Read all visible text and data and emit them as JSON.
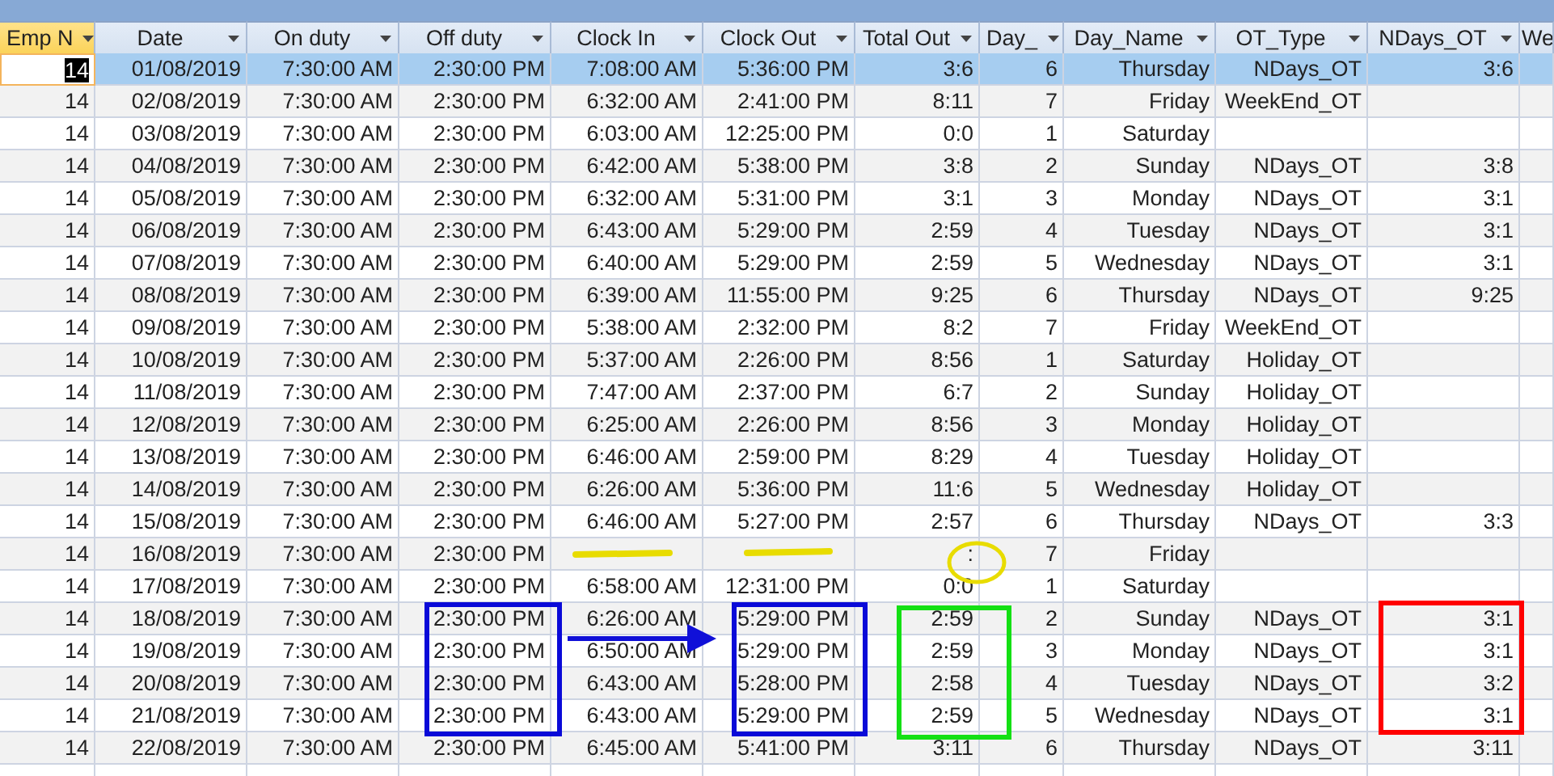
{
  "table": {
    "columns": [
      {
        "label": "Emp N",
        "selected": true
      },
      {
        "label": "Date",
        "selected": false
      },
      {
        "label": "On duty",
        "selected": false
      },
      {
        "label": "Off duty",
        "selected": false
      },
      {
        "label": "Clock In",
        "selected": false
      },
      {
        "label": "Clock Out",
        "selected": false
      },
      {
        "label": "Total Out",
        "selected": false
      },
      {
        "label": "Day_",
        "selected": false
      },
      {
        "label": "Day_Name",
        "selected": false
      },
      {
        "label": "OT_Type",
        "selected": false
      },
      {
        "label": "NDays_OT",
        "selected": false
      },
      {
        "label": "We",
        "selected": false
      }
    ],
    "rows": [
      {
        "selected": true,
        "cells": [
          "14",
          "01/08/2019",
          "7:30:00 AM",
          "2:30:00 PM",
          "7:08:00 AM",
          "5:36:00 PM",
          "3:6",
          "6",
          "Thursday",
          "NDays_OT",
          "3:6"
        ]
      },
      {
        "selected": false,
        "cells": [
          "14",
          "02/08/2019",
          "7:30:00 AM",
          "2:30:00 PM",
          "6:32:00 AM",
          "2:41:00 PM",
          "8:11",
          "7",
          "Friday",
          "WeekEnd_OT",
          ""
        ]
      },
      {
        "selected": false,
        "cells": [
          "14",
          "03/08/2019",
          "7:30:00 AM",
          "2:30:00 PM",
          "6:03:00 AM",
          "12:25:00 PM",
          "0:0",
          "1",
          "Saturday",
          "",
          ""
        ]
      },
      {
        "selected": false,
        "cells": [
          "14",
          "04/08/2019",
          "7:30:00 AM",
          "2:30:00 PM",
          "6:42:00 AM",
          "5:38:00 PM",
          "3:8",
          "2",
          "Sunday",
          "NDays_OT",
          "3:8"
        ]
      },
      {
        "selected": false,
        "cells": [
          "14",
          "05/08/2019",
          "7:30:00 AM",
          "2:30:00 PM",
          "6:32:00 AM",
          "5:31:00 PM",
          "3:1",
          "3",
          "Monday",
          "NDays_OT",
          "3:1"
        ]
      },
      {
        "selected": false,
        "cells": [
          "14",
          "06/08/2019",
          "7:30:00 AM",
          "2:30:00 PM",
          "6:43:00 AM",
          "5:29:00 PM",
          "2:59",
          "4",
          "Tuesday",
          "NDays_OT",
          "3:1"
        ]
      },
      {
        "selected": false,
        "cells": [
          "14",
          "07/08/2019",
          "7:30:00 AM",
          "2:30:00 PM",
          "6:40:00 AM",
          "5:29:00 PM",
          "2:59",
          "5",
          "Wednesday",
          "NDays_OT",
          "3:1"
        ]
      },
      {
        "selected": false,
        "cells": [
          "14",
          "08/08/2019",
          "7:30:00 AM",
          "2:30:00 PM",
          "6:39:00 AM",
          "11:55:00 PM",
          "9:25",
          "6",
          "Thursday",
          "NDays_OT",
          "9:25"
        ]
      },
      {
        "selected": false,
        "cells": [
          "14",
          "09/08/2019",
          "7:30:00 AM",
          "2:30:00 PM",
          "5:38:00 AM",
          "2:32:00 PM",
          "8:2",
          "7",
          "Friday",
          "WeekEnd_OT",
          ""
        ]
      },
      {
        "selected": false,
        "cells": [
          "14",
          "10/08/2019",
          "7:30:00 AM",
          "2:30:00 PM",
          "5:37:00 AM",
          "2:26:00 PM",
          "8:56",
          "1",
          "Saturday",
          "Holiday_OT",
          ""
        ]
      },
      {
        "selected": false,
        "cells": [
          "14",
          "11/08/2019",
          "7:30:00 AM",
          "2:30:00 PM",
          "7:47:00 AM",
          "2:37:00 PM",
          "6:7",
          "2",
          "Sunday",
          "Holiday_OT",
          ""
        ]
      },
      {
        "selected": false,
        "cells": [
          "14",
          "12/08/2019",
          "7:30:00 AM",
          "2:30:00 PM",
          "6:25:00 AM",
          "2:26:00 PM",
          "8:56",
          "3",
          "Monday",
          "Holiday_OT",
          ""
        ]
      },
      {
        "selected": false,
        "cells": [
          "14",
          "13/08/2019",
          "7:30:00 AM",
          "2:30:00 PM",
          "6:46:00 AM",
          "2:59:00 PM",
          "8:29",
          "4",
          "Tuesday",
          "Holiday_OT",
          ""
        ]
      },
      {
        "selected": false,
        "cells": [
          "14",
          "14/08/2019",
          "7:30:00 AM",
          "2:30:00 PM",
          "6:26:00 AM",
          "5:36:00 PM",
          "11:6",
          "5",
          "Wednesday",
          "Holiday_OT",
          ""
        ]
      },
      {
        "selected": false,
        "cells": [
          "14",
          "15/08/2019",
          "7:30:00 AM",
          "2:30:00 PM",
          "6:46:00 AM",
          "5:27:00 PM",
          "2:57",
          "6",
          "Thursday",
          "NDays_OT",
          "3:3"
        ]
      },
      {
        "selected": false,
        "cells": [
          "14",
          "16/08/2019",
          "7:30:00 AM",
          "2:30:00 PM",
          "",
          "",
          ":",
          "7",
          "Friday",
          "",
          ""
        ]
      },
      {
        "selected": false,
        "cells": [
          "14",
          "17/08/2019",
          "7:30:00 AM",
          "2:30:00 PM",
          "6:58:00 AM",
          "12:31:00 PM",
          "0:0",
          "1",
          "Saturday",
          "",
          ""
        ]
      },
      {
        "selected": false,
        "cells": [
          "14",
          "18/08/2019",
          "7:30:00 AM",
          "2:30:00 PM",
          "6:26:00 AM",
          "5:29:00 PM",
          "2:59",
          "2",
          "Sunday",
          "NDays_OT",
          "3:1"
        ]
      },
      {
        "selected": false,
        "cells": [
          "14",
          "19/08/2019",
          "7:30:00 AM",
          "2:30:00 PM",
          "6:50:00 AM",
          "5:29:00 PM",
          "2:59",
          "3",
          "Monday",
          "NDays_OT",
          "3:1"
        ]
      },
      {
        "selected": false,
        "cells": [
          "14",
          "20/08/2019",
          "7:30:00 AM",
          "2:30:00 PM",
          "6:43:00 AM",
          "5:28:00 PM",
          "2:58",
          "4",
          "Tuesday",
          "NDays_OT",
          "3:2"
        ]
      },
      {
        "selected": false,
        "cells": [
          "14",
          "21/08/2019",
          "7:30:00 AM",
          "2:30:00 PM",
          "6:43:00 AM",
          "5:29:00 PM",
          "2:59",
          "5",
          "Wednesday",
          "NDays_OT",
          "3:1"
        ]
      },
      {
        "selected": false,
        "cells": [
          "14",
          "22/08/2019",
          "7:30:00 AM",
          "2:30:00 PM",
          "6:45:00 AM",
          "5:41:00 PM",
          "3:11",
          "6",
          "Thursday",
          "NDays_OT",
          "3:11"
        ]
      }
    ]
  }
}
